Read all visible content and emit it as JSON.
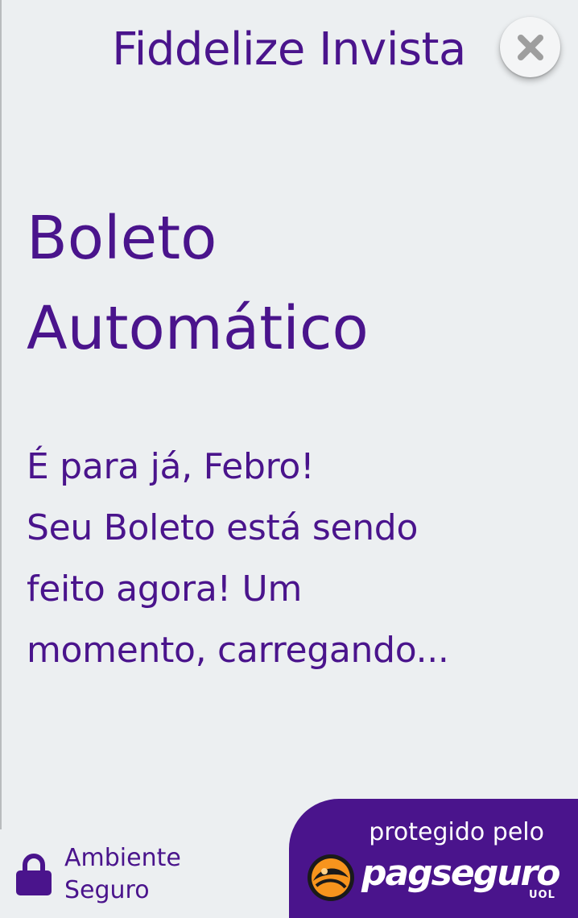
{
  "header": {
    "title": "Fiddelize Invista",
    "close_icon": "close-icon"
  },
  "main": {
    "heading_line1": "Boleto",
    "heading_line2": "Automático",
    "message_lines": [
      "É para já, Febro!",
      "Seu Boleto está sendo",
      "feito agora! Um",
      "momento, carregando..."
    ]
  },
  "footer": {
    "secure_icon": "lock-icon",
    "secure_line1": "Ambiente",
    "secure_line2": "Seguro",
    "badge_caption": "protegido pelo",
    "badge_logo_text": "pagseguro",
    "badge_logo_sub": "UOL"
  },
  "colors": {
    "background": "#eceff1",
    "primary": "#4a148c",
    "close_button_bg": "#f4f5f6",
    "close_icon": "#9e9e9e",
    "badge_text": "#ffffff",
    "logo_orange": "#f7941d"
  }
}
